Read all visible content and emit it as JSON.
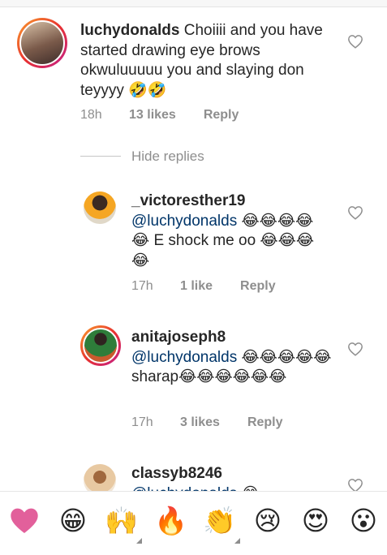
{
  "comments": [
    {
      "username": "luchydonalds",
      "text": " Choiiii and you have started drawing eye brows okwuluuuuu you and slaying don teyyyy 🤣🤣",
      "time": "18h",
      "likes": "13 likes",
      "reply": "Reply"
    }
  ],
  "hide_replies": "Hide replies",
  "replies": [
    {
      "username": "_victoresther19",
      "mention": "@luchydonalds",
      "text": " 😂😂😂😂😂 E shock me oo 😂😂😂😂",
      "time": "17h",
      "likes": "1 like",
      "reply": "Reply"
    },
    {
      "username": "anitajoseph8",
      "mention": "@luchydonalds",
      "text": " 😂😂😂😂😂sharap😂😂😂😂😂😂",
      "time": "17h",
      "likes": "3 likes",
      "reply": "Reply"
    },
    {
      "username": "classyb8246",
      "mention": "@luchydonalds",
      "text": " 😂"
    }
  ],
  "emoji_bar": [
    {
      "icon": "heart-icon",
      "glyph": "❤"
    },
    {
      "icon": "grinning-squint-icon",
      "glyph": "😁"
    },
    {
      "icon": "raising-hands-icon",
      "glyph": "🙌"
    },
    {
      "icon": "fire-icon",
      "glyph": "🔥"
    },
    {
      "icon": "clapping-hands-icon",
      "glyph": "👏"
    },
    {
      "icon": "sad-face-icon",
      "glyph": "😢"
    },
    {
      "icon": "heart-eyes-icon",
      "glyph": "😍"
    },
    {
      "icon": "astonished-face-icon",
      "glyph": "😮"
    }
  ],
  "colors": {
    "mention": "#003569",
    "meta": "#8e8e8e",
    "heart": "#ed4956"
  }
}
